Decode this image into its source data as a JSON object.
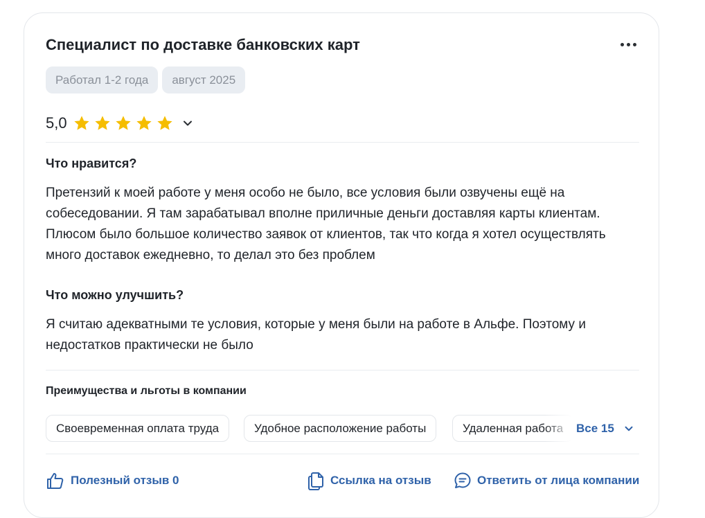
{
  "review": {
    "title": "Специалист по доставке банковских карт",
    "tags": [
      "Работал 1-2 года",
      "август 2025"
    ],
    "rating": "5,0",
    "stars_filled": 5,
    "stars_total": 5,
    "likes_heading": "Что нравится?",
    "likes_text": "Претензий к моей работе у меня особо не было, все условия были озвучены ещё на собеседовании. Я там зарабатывал вполне приличные деньги доставляя карты клиентам. Плюсом было большое количество заявок от клиентов, так что когда я хотел осуществлять много доставок ежедневно, то делал это без проблем",
    "improve_heading": "Что можно улучшить?",
    "improve_text": "Я считаю адекватными те условия, которые у меня были на работе в Альфе. Поэтому и недостатков практически не было"
  },
  "benefits": {
    "heading": "Преимущества и льготы в компании",
    "items": [
      "Своевременная оплата труда",
      "Удобное расположение работы",
      "Удаленная работа"
    ],
    "all_label": "Все 15"
  },
  "footer": {
    "helpful_label": "Полезный отзыв 0",
    "link_label": "Ссылка на отзыв",
    "reply_label": "Ответить от лица компании"
  },
  "colors": {
    "accent": "#2f62a9",
    "star": "#f5bd00",
    "chip_bg": "#e9edf2",
    "chip_text": "#8a9099"
  },
  "icons": {
    "more": "more-dots-icon",
    "star": "star-icon",
    "chevron": "chevron-down-icon",
    "thumb": "thumbs-up-icon",
    "copy": "copy-link-icon",
    "comment": "comment-icon"
  }
}
